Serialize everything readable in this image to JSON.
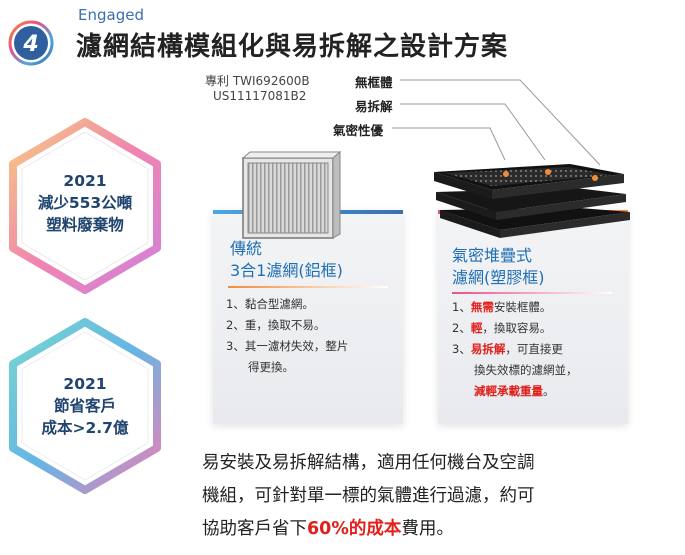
{
  "header": {
    "step_number": "4",
    "engaged": "Engaged",
    "title": "濾網結構模組化與易拆解之設計方案"
  },
  "patent": {
    "line1": "專利 TWI692600B",
    "line2": "US11117081B2"
  },
  "features": [
    "無框體",
    "易拆解",
    "氣密性優"
  ],
  "hex_top": {
    "year": "2021",
    "line1": "減少553公噸",
    "line2": "塑料廢棄物"
  },
  "hex_bottom": {
    "year": "2021",
    "line1": "節省客戶",
    "line2": "成本>2.7億"
  },
  "card_left": {
    "title1": "傳統",
    "title2": "3合1濾網(鋁框)",
    "items": [
      {
        "num": "1、",
        "text": "黏合型濾網。"
      },
      {
        "num": "2、",
        "text": "重，換取不易。"
      },
      {
        "num": "3、",
        "text": "其一濾材失效，整片"
      },
      {
        "num": "",
        "text": "得更換。"
      }
    ]
  },
  "card_right": {
    "title1": "氣密堆疊式",
    "title2": "濾網(塑膠框)",
    "item1_num": "1、",
    "item1_red": "無需",
    "item1_rest": "安裝框體。",
    "item2_num": "2、",
    "item2_red": "輕",
    "item2_rest": "，換取容易。",
    "item3_num": "3、",
    "item3_red": "易拆解",
    "item3_rest": "，可直接更",
    "item4": "換失效標的濾網並，",
    "item5_red": "減輕承載重量",
    "item5_rest": "。"
  },
  "bottom": {
    "line1": "易安裝及易拆解結構，適用任何機台及空調",
    "line2": "機組，可針對單一標的氣體進行過濾，約可",
    "line3_pre": "協助客戶省下",
    "line3_hl": "60%的成本",
    "line3_post": "費用。"
  },
  "colors": {
    "title_blue": "#3a6fb0",
    "card_blue": "#1f6fb5",
    "highlight_red": "#e0201b",
    "hex_text": "#21446f"
  }
}
